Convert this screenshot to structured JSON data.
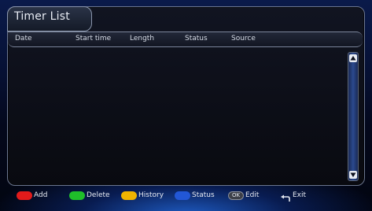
{
  "window": {
    "title": "Timer List"
  },
  "table": {
    "columns": [
      "Date",
      "Start time",
      "Length",
      "Status",
      "Source"
    ],
    "rows": []
  },
  "legend": {
    "add": {
      "label": "Add",
      "color": "#e21b1b"
    },
    "delete": {
      "label": "Delete",
      "color": "#1fbf2a"
    },
    "history": {
      "label": "History",
      "color": "#f0b400"
    },
    "status": {
      "label": "Status",
      "color": "#2257d6"
    },
    "ok": {
      "key": "OK",
      "label": "Edit"
    },
    "exit": {
      "label": "Exit",
      "icon": "back-arrow-icon"
    }
  },
  "colors": {
    "background": "#061033",
    "panel": "#0b0d14",
    "border": "#7c869c",
    "text": "#e6eaf2"
  }
}
